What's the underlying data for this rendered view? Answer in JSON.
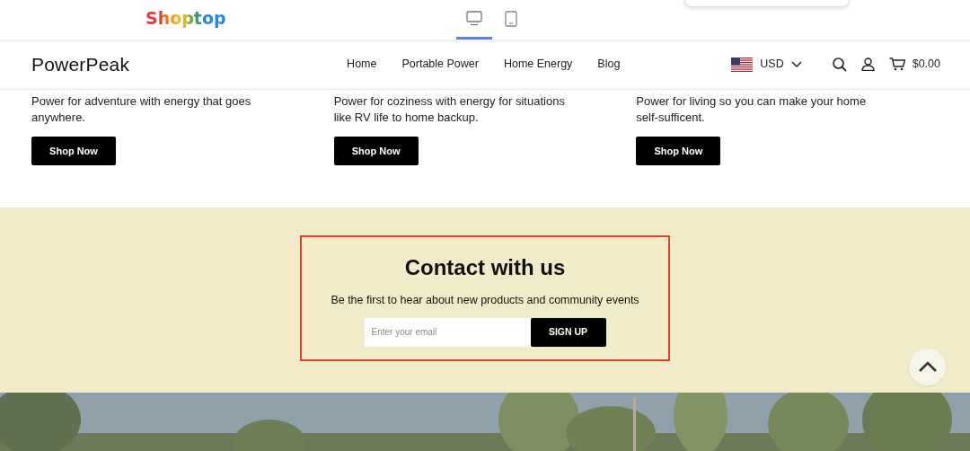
{
  "editor_bar": {
    "logo": "Shoptop",
    "devices": [
      {
        "kind": "desktop",
        "selected": true
      },
      {
        "kind": "tablet",
        "selected": false
      }
    ]
  },
  "header": {
    "brand": "PowerPeak",
    "nav": [
      {
        "label": "Home"
      },
      {
        "label": "Portable Power"
      },
      {
        "label": "Home Energy"
      },
      {
        "label": "Blog"
      }
    ],
    "currency": "USD",
    "cart_total": "$0.00"
  },
  "collections": [
    {
      "text": "Power for adventure with energy that goes anywhere.",
      "button": "Shop Now"
    },
    {
      "text": "Power for coziness with energy for situations like RV life to home backup.",
      "button": "Shop Now"
    },
    {
      "text": "Power for living so you can make your home self-sufficent.",
      "button": "Shop Now"
    }
  ],
  "newsletter": {
    "title": "Contact with us",
    "subtitle": "Be the first to hear about new products and community events",
    "placeholder": "Enter your email",
    "button": "SIGN UP",
    "highlighted": true
  }
}
